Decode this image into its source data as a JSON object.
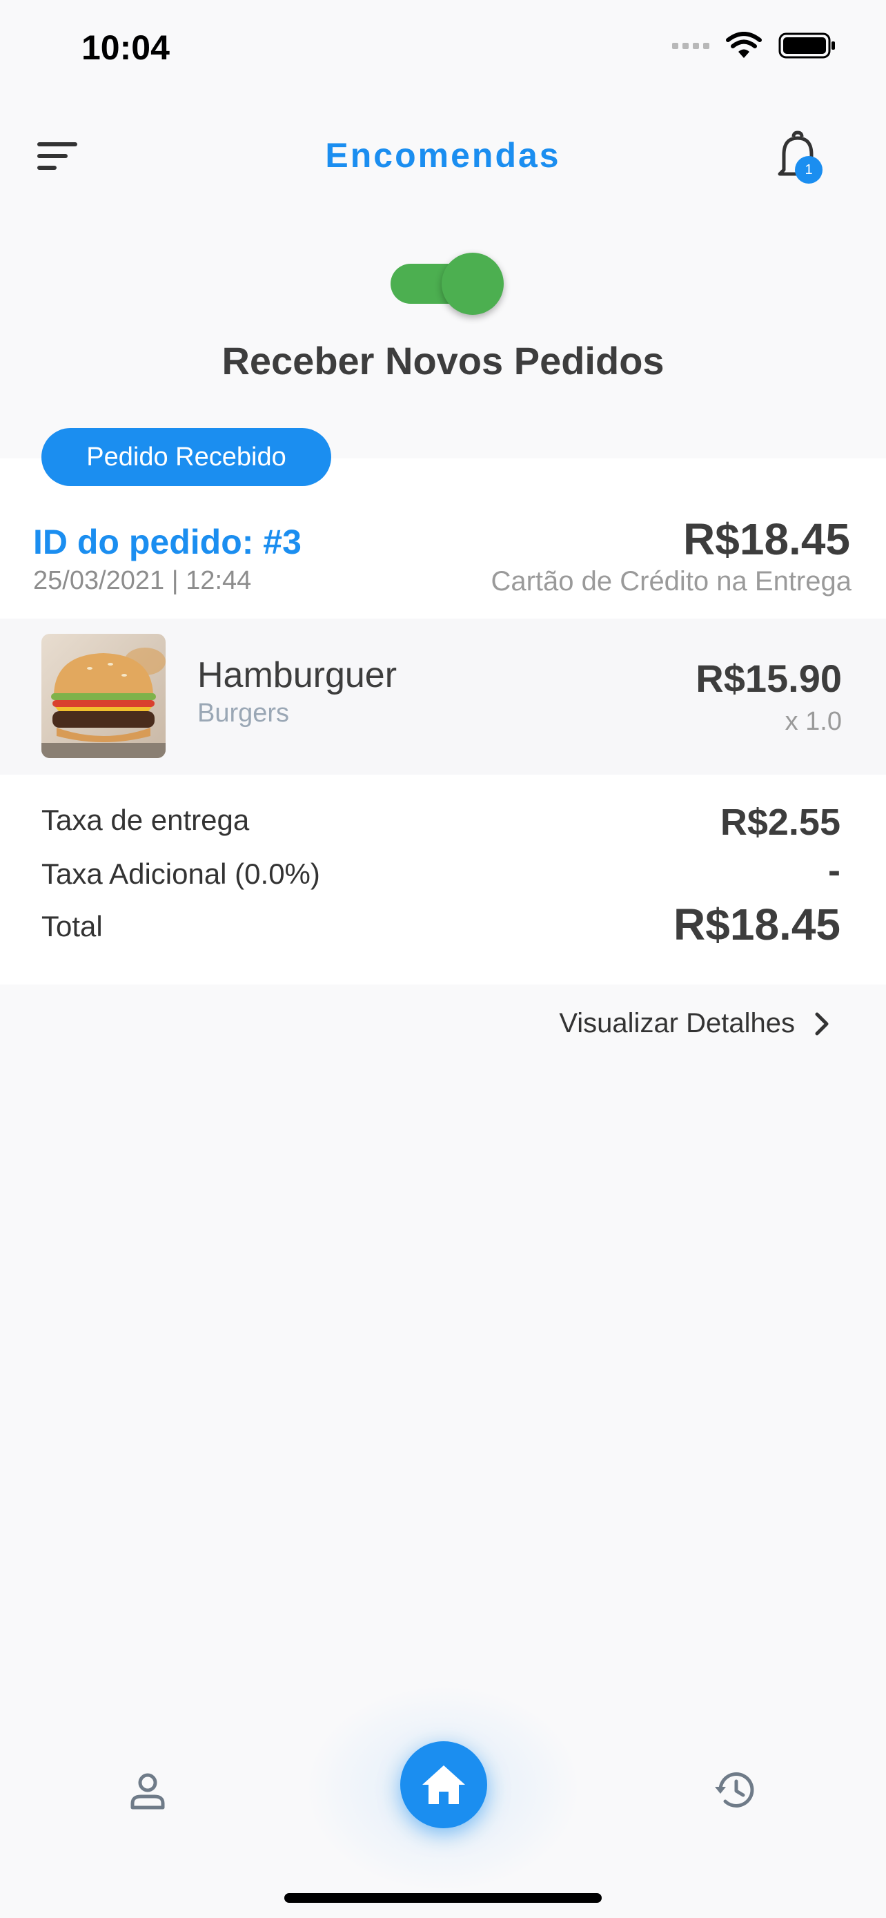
{
  "status_bar": {
    "time": "10:04"
  },
  "header": {
    "title": "Encomendas",
    "notification_count": "1"
  },
  "toggle": {
    "label": "Receber Novos Pedidos",
    "on": true
  },
  "order": {
    "status": "Pedido Recebido",
    "id_label": "ID do pedido: #3",
    "datetime": "25/03/2021 | 12:44",
    "total": "R$18.45",
    "payment_method": "Cartão de Crédito na Entrega",
    "items": [
      {
        "name": "Hamburguer",
        "category": "Burgers",
        "price": "R$15.90",
        "quantity": "x 1.0"
      }
    ],
    "fees": [
      {
        "label": "Taxa de entrega",
        "value": "R$2.55"
      },
      {
        "label": "Taxa Adicional (0.0%)",
        "value": "-"
      },
      {
        "label": "Total",
        "value": "R$18.45"
      }
    ]
  },
  "details_link": "Visualizar Detalhes",
  "colors": {
    "accent": "#1b8ef0",
    "toggle_on": "#4caf50",
    "text_dark": "#3d3d3d"
  },
  "icons": {
    "menu": "menu-icon",
    "bell": "bell-icon",
    "profile": "user-icon",
    "home": "home-icon",
    "history": "history-icon",
    "chevron": "chevron-right-icon"
  }
}
